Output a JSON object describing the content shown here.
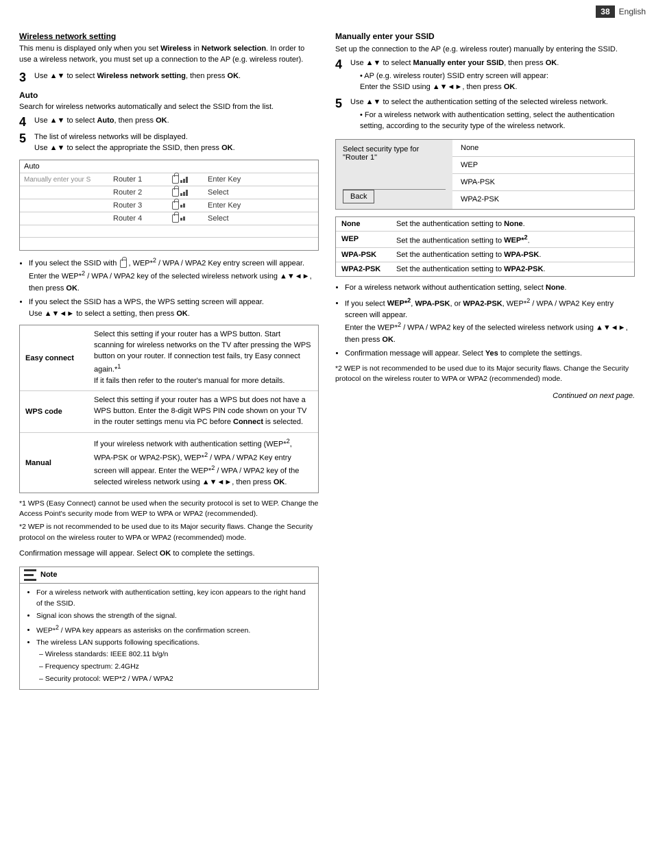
{
  "page": {
    "number": "38",
    "lang": "English"
  },
  "left": {
    "section_title": "Wireless network setting",
    "intro": "This menu is displayed only when you set Wireless in Network selection. In order to use a wireless network, you must set up a connection to the AP (e.g. wireless router).",
    "step3": {
      "num": "3",
      "text": "Use ▲▼ to select Wireless network setting, then press OK."
    },
    "auto": {
      "title": "Auto",
      "desc": "Search for wireless networks automatically and select the SSID from the list."
    },
    "step4": {
      "num": "4",
      "text": "Use ▲▼ to select Auto, then press OK."
    },
    "step5": {
      "num": "5",
      "text1": "The list of wireless networks will be displayed.",
      "text2": "Use ▲▼ to select the appropriate the SSID, then press OK."
    },
    "network_list": [
      {
        "col1": "Auto",
        "col2": "",
        "icon": "",
        "action": ""
      },
      {
        "col1": "Manually enter your S",
        "col2": "Router 1",
        "locked": true,
        "signal": 3,
        "action": "Enter Key"
      },
      {
        "col1": "",
        "col2": "Router 2",
        "locked": true,
        "signal": 3,
        "action": "Select"
      },
      {
        "col1": "",
        "col2": "Router 3",
        "locked": true,
        "signal": 2,
        "action": "Enter Key"
      },
      {
        "col1": "",
        "col2": "Router 4",
        "locked": true,
        "signal": 2,
        "action": "Select"
      }
    ],
    "bullets": [
      "If you select the SSID with 🔒, WEP*2 / WPA / WPA2 Key entry screen will appear.\nEnter the WEP*2 / WPA / WPA2 key of the selected wireless network using ▲▼◄►, then press OK.",
      "If you select the SSID has a WPS, the WPS setting screen will appear.\nUse ▲▼◄► to select a setting, then press OK."
    ],
    "wps_table": [
      {
        "label": "Easy connect",
        "desc": "Select this setting if your router has a WPS button. Start scanning for wireless networks on the TV after pressing the WPS button on your router. If connection test fails, try Easy connect again.*1\nIf it fails then refer to the router's manual for more details."
      },
      {
        "label": "WPS code",
        "desc": "Select this setting if your router has a WPS but does not have a WPS button. Enter the 8-digit WPS PIN code shown on your TV in the router settings menu via PC before Connect is selected."
      },
      {
        "label": "Manual",
        "desc": "If your wireless network with authentication setting (WEP*2, WPA-PSK or WPA2-PSK), WEP*2 / WPA / WPA2 Key entry screen will appear. Enter the WEP*2 / WPA / WPA2 key of the selected wireless network using ▲▼◄►, then press OK."
      }
    ],
    "footnotes": [
      "*1 WPS (Easy Connect) cannot be used when the security protocol is set to WEP. Change the Access Point's security mode from WEP to WPA or WPA2 (recommended).",
      "*2 WEP is not recommended to be used due to its Major security flaws. Change the Security protocol on the wireless router to WPA or WPA2 (recommended) mode."
    ],
    "confirm": "Confirmation message will appear. Select OK to complete the settings.",
    "note": {
      "title": "Note",
      "bullets": [
        "For a wireless network with authentication setting, key icon appears to the right hand of the SSID.",
        "Signal icon shows the strength of the signal.",
        "WEP*2 / WPA key appears as asterisks on the confirmation screen.",
        "The wireless LAN supports following specifications."
      ],
      "specs": [
        {
          "label": "– Wireless standards:",
          "value": "IEEE 802.11 b/g/n"
        },
        {
          "label": "– Frequency spectrum:",
          "value": "2.4GHz"
        },
        {
          "label": "– Security protocol:",
          "value": "WEP*2 / WPA / WPA2"
        }
      ]
    }
  },
  "right": {
    "section_title": "Manually enter your SSID",
    "intro": "Set up the connection to the AP (e.g. wireless router) manually by entering the SSID.",
    "step4": {
      "num": "4",
      "text": "Use ▲▼ to select Manually enter your SSID, then press OK.",
      "sub": "• AP (e.g. wireless router) SSID entry screen will appear: Enter the SSID using ▲▼◄►, then press OK."
    },
    "step5": {
      "num": "5",
      "text": "Use ▲▼ to select the authentication setting of the selected wireless network.",
      "sub": "• For a wireless network with authentication setting, select the authentication setting, according to the security type of the wireless network."
    },
    "security_box": {
      "left_title": "Select security type for\n\"Router 1\"",
      "options": [
        "None",
        "WEP",
        "WPA-PSK",
        "WPA2-PSK"
      ],
      "back_label": "Back"
    },
    "auth_table": [
      {
        "key": "None",
        "val": "Set the authentication setting to None."
      },
      {
        "key": "WEP",
        "val": "Set the authentication setting to WEP*2."
      },
      {
        "key": "WPA-PSK",
        "val": "Set the authentication setting to WPA-PSK."
      },
      {
        "key": "WPA2-PSK",
        "val": "Set the authentication setting to WPA2-PSK."
      }
    ],
    "bullets": [
      "For a wireless network without authentication setting, select None.",
      "If you select WEP*2, WPA-PSK, or WPA2-PSK, WEP*2 / WPA / WPA2 Key entry screen will appear.\nEnter the WEP*2 / WPA / WPA2 key of the selected wireless network using ▲▼◄►, then press OK.",
      "Confirmation message will appear. Select Yes to complete the settings."
    ],
    "footnotes": [
      "*2 WEP is not recommended to be used due to its Major security flaws. Change the Security protocol on the wireless router to WPA or WPA2 (recommended) mode."
    ],
    "continued": "Continued on next page."
  }
}
